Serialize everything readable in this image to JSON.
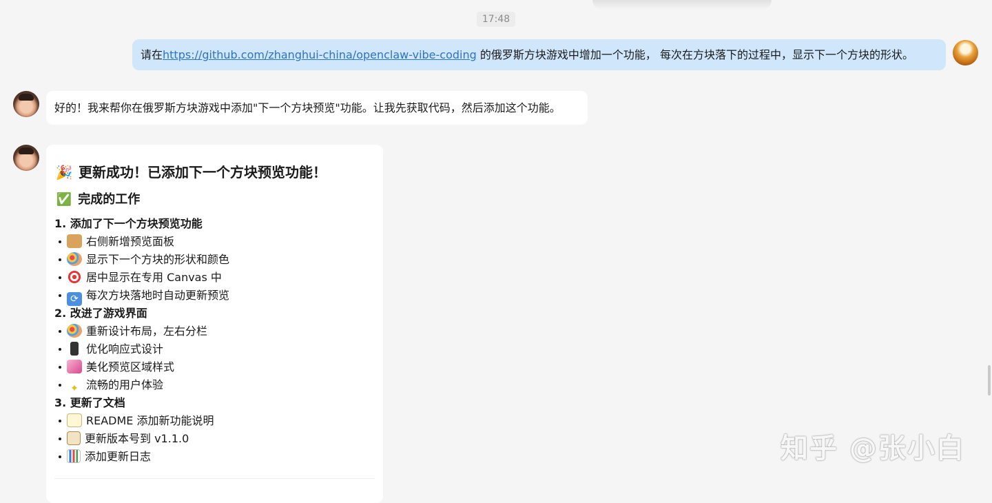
{
  "timestamp": "17:48",
  "user_message": {
    "prefix": "请在",
    "link": "https://github.com/zhanghui-china/openclaw-vibe-coding",
    "suffix": " 的俄罗斯方块游戏中增加一个功能， 每次在方块落下的过程中，显示下一个方块的形状。"
  },
  "bot_message_1": "好的！我来帮你在俄罗斯方块游戏中添加\"下一个方块预览\"功能。让我先获取代码，然后添加这个功能。",
  "bot_message_2": {
    "title_emoji": "🎉",
    "title": "更新成功！已添加下一个方块预览功能！",
    "subtitle_emoji": "✅",
    "subtitle": "完成的工作",
    "sections": [
      {
        "heading": "1. 添加了下一个方块预览功能",
        "items": [
          {
            "icon": "package-icon",
            "text": "右侧新增预览面板"
          },
          {
            "icon": "palette-icon",
            "text": "显示下一个方块的形状和颜色"
          },
          {
            "icon": "target-icon",
            "text": "居中显示在专用 Canvas 中"
          },
          {
            "icon": "refresh-icon",
            "text": "每次方块落地时自动更新预览"
          }
        ]
      },
      {
        "heading": "2. 改进了游戏界面",
        "items": [
          {
            "icon": "palette-icon",
            "text": "重新设计布局，左右分栏"
          },
          {
            "icon": "phone-icon",
            "text": "优化响应式设计"
          },
          {
            "icon": "nail-polish-icon",
            "text": "美化预览区域样式"
          },
          {
            "icon": "sparkles-icon",
            "text": "流畅的用户体验"
          }
        ]
      },
      {
        "heading": "3. 更新了文档",
        "items": [
          {
            "icon": "memo-icon",
            "text": "README 添加新功能说明"
          },
          {
            "icon": "clipboard-icon",
            "text": "更新版本号到 v1.1.0"
          },
          {
            "icon": "bar-chart-icon",
            "text": "添加更新日志"
          }
        ]
      }
    ]
  },
  "watermark": "知乎 @张小白"
}
